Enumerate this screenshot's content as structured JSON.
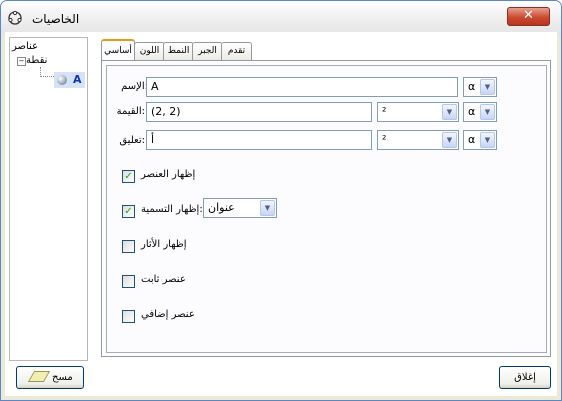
{
  "window": {
    "title": "الخاصيات",
    "close_glyph": "✕",
    "app_icon": "gear-icon"
  },
  "tree": {
    "root_label": "عناصر",
    "expander_glyph": "−",
    "node_label": "نقطة",
    "leaf_label": "A",
    "leaf_icon": "point-ball-icon"
  },
  "tabs": [
    "أساسي",
    "اللون",
    "النمط",
    "الجبر",
    "تقدم"
  ],
  "basic": {
    "name_label": "الإسم:",
    "name_value": "A",
    "value_label": "القيمة:",
    "value_value": "(2, 2)",
    "caption_label": "تعليق:",
    "caption_value": "أ",
    "alpha_symbol": "α",
    "combo_value": "²",
    "dropdown_arrow": "▼",
    "show_object": {
      "label": "إظهار العنصر",
      "checked": true
    },
    "show_label": {
      "label": "إظهار التسمية:",
      "checked": true,
      "select_value": "عنوان"
    },
    "show_trace": {
      "label": "إظهار الأثار",
      "checked": false
    },
    "fix_object": {
      "label": "عنصر ثابت",
      "checked": false
    },
    "aux_object": {
      "label": "عنصر إضافي",
      "checked": false
    },
    "check_glyph": "✓"
  },
  "footer": {
    "delete_label": "مسح",
    "close_label": "إغلاق"
  }
}
